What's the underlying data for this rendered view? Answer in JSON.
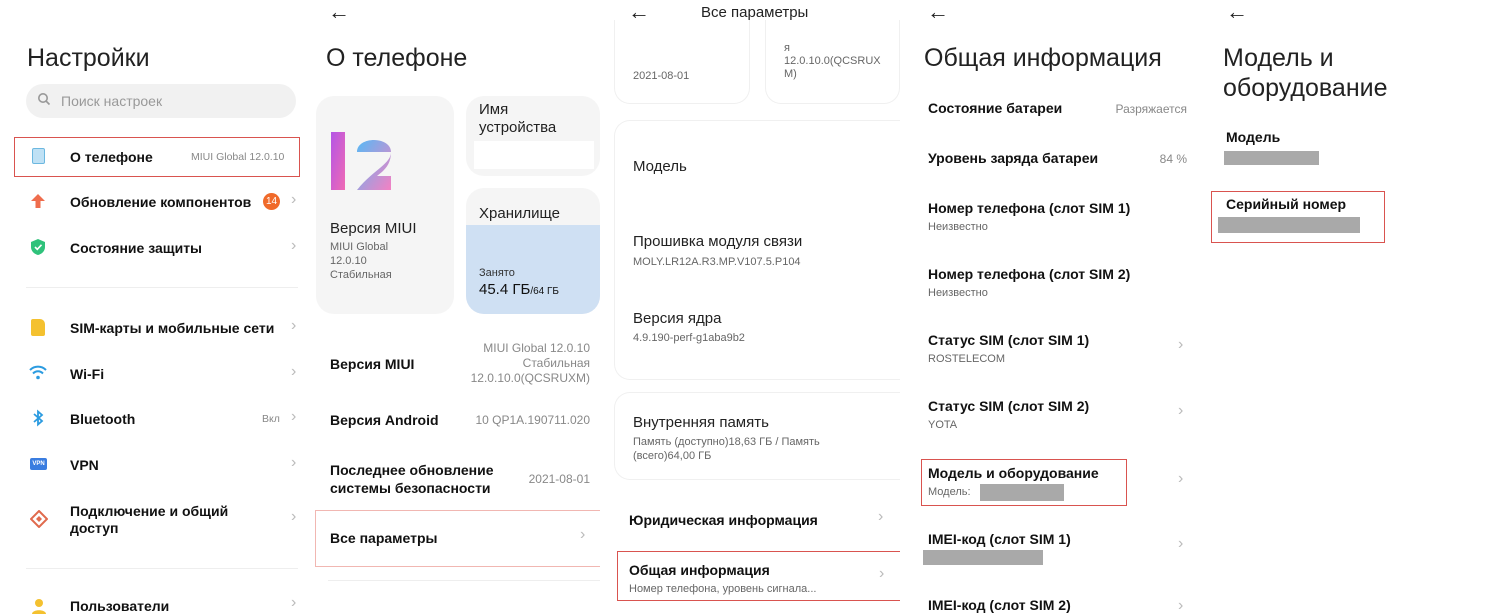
{
  "s1": {
    "title": "Настройки",
    "search_placeholder": "Поиск настроек",
    "about": {
      "label": "О телефоне",
      "value": "MIUI Global 12.0.10"
    },
    "update": {
      "label": "Обновление компонентов",
      "badge": "14"
    },
    "protection": {
      "label": "Состояние защиты"
    },
    "sim": {
      "label": "SIM-карты и мобильные сети"
    },
    "wifi": {
      "label": "Wi-Fi"
    },
    "bluetooth": {
      "label": "Bluetooth",
      "value": "Вкл"
    },
    "vpn": {
      "label": "VPN",
      "icon_text": "VPN"
    },
    "tethering": {
      "label_line1": "Подключение и общий",
      "label_line2": "доступ"
    },
    "users": {
      "label": "Пользователи"
    }
  },
  "s2": {
    "title": "О телефоне",
    "miui_card": {
      "label": "Версия MIUI",
      "line1": "MIUI Global",
      "line2": "12.0.10",
      "line3": "Стабильная",
      "logo_text": "12"
    },
    "device_card": {
      "label_line1": "Имя",
      "label_line2": "устройства"
    },
    "storage_card": {
      "label": "Хранилище",
      "used_label": "Занято",
      "used_value": "45.4 ГБ",
      "total": "/64 ГБ"
    },
    "miui_row": {
      "label": "Версия MIUI",
      "v1": "MIUI Global 12.0.10",
      "v2": "Стабильная",
      "v3": "12.0.10.0(QCSRUXM)"
    },
    "android_row": {
      "label": "Версия Android",
      "value": "10 QP1A.190711.020"
    },
    "security_row": {
      "label_line1": "Последнее обновление",
      "label_line2": "системы безопасности",
      "value": "2021-08-01"
    },
    "all_params": {
      "label": "Все параметры"
    }
  },
  "s3": {
    "header": "Все параметры",
    "top_left_value": "2021-08-01",
    "top_right_l1": "я",
    "top_right_l2": "12.0.10.0(QCSRUX",
    "top_right_l3": "M)",
    "model": {
      "label": "Модель"
    },
    "baseband": {
      "label": "Прошивка модуля связи",
      "value": "MOLY.LR12A.R3.MP.V107.5.P104"
    },
    "kernel": {
      "label": "Версия ядра",
      "value": "4.9.190-perf-g1aba9b2"
    },
    "storage": {
      "label": "Внутренняя память",
      "value_l1": "Память (доступно)18,63 ГБ / Память",
      "value_l2": "(всего)64,00 ГБ"
    },
    "legal": {
      "label": "Юридическая информация"
    },
    "general": {
      "label": "Общая информация",
      "sub": "Номер телефона, уровень сигнала..."
    }
  },
  "s4": {
    "title": "Общая информация",
    "battery_state": {
      "label": "Состояние батареи",
      "value": "Разряжается"
    },
    "battery_level": {
      "label": "Уровень заряда батареи",
      "value": "84 %"
    },
    "phone_sim1": {
      "label": "Номер телефона (слот SIM 1)",
      "value": "Неизвестно"
    },
    "phone_sim2": {
      "label": "Номер телефона (слот SIM 2)",
      "value": "Неизвестно"
    },
    "status_sim1": {
      "label": "Статус SIM (слот SIM 1)",
      "value": "ROSTELECOM"
    },
    "status_sim2": {
      "label": "Статус SIM (слот SIM 2)",
      "value": "YOTA"
    },
    "model_hw": {
      "label": "Модель и оборудование",
      "value_label": "Модель:"
    },
    "imei1": {
      "label": "IMEI-код (слот SIM 1)"
    },
    "imei2": {
      "label": "IMEI-код (слот SIM 2)"
    }
  },
  "s5": {
    "title_l1": "Модель и",
    "title_l2": "оборудование",
    "model": {
      "label": "Модель"
    },
    "serial": {
      "label": "Серийный номер"
    }
  },
  "common": {
    "back_arrow": "←",
    "chevron": "›"
  },
  "colors": {
    "highlight": "#d9534f",
    "storage_blue": "#cfe0f3",
    "shield_green": "#2fc27b",
    "update_orange": "#ef6d4d",
    "sim_yellow": "#f4c12f",
    "wifi_blue": "#2b9be0",
    "vpn_blue": "#3a7de0",
    "share_red": "#e06a4d"
  }
}
